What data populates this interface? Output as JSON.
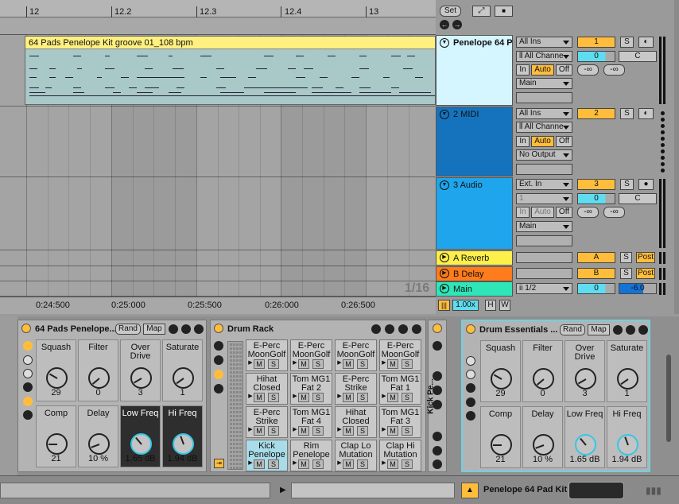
{
  "arrangement": {
    "ruler_marks": [
      "12",
      "12.2",
      "12.3",
      "12.4",
      "13"
    ],
    "time_marks": [
      "0:24:500",
      "0:25:000",
      "0:25:500",
      "0:26:000",
      "0:26:500"
    ],
    "zoom_label": "1/16",
    "set_button": "Set",
    "clip_name": "64 Pads Penelope Kit groove 01_108 bpm"
  },
  "tracks": [
    {
      "name": "Penelope 64 P",
      "input": "All Ins",
      "channel": "All Channe",
      "monitor": [
        "In",
        "Auto",
        "Off"
      ],
      "output": "Main",
      "number": "1",
      "solo": "S",
      "volume": "0",
      "pan": "C",
      "send_a": "-∞",
      "send_b": "-∞"
    },
    {
      "name": "2 MIDI",
      "input": "All Ins",
      "channel": "All Channe",
      "monitor": [
        "In",
        "Auto",
        "Off"
      ],
      "output": "No Output",
      "number": "2",
      "solo": "S"
    },
    {
      "name": "3 Audio",
      "input": "Ext. In",
      "channel": "1",
      "monitor": [
        "In",
        "Auto",
        "Off"
      ],
      "output": "Main",
      "number": "3",
      "solo": "S",
      "volume": "0",
      "pan": "C",
      "send_a": "-∞",
      "send_b": "-∞"
    },
    {
      "name": "A Reverb",
      "number": "A",
      "solo": "S",
      "post": "Post"
    },
    {
      "name": "B Delay",
      "number": "B",
      "solo": "S",
      "post": "Post"
    },
    {
      "name": "Main",
      "cue": "1/2",
      "volume": "0",
      "master_vol": "-6.0"
    }
  ],
  "transport": {
    "tempo_scale": "1.00x",
    "h_label": "H",
    "w_label": "W"
  },
  "devices": {
    "rack1": {
      "title": "64 Pads Penelope...",
      "rand": "Rand",
      "map": "Map",
      "macros": [
        {
          "label": "Squash",
          "value": "29"
        },
        {
          "label": "Filter",
          "value": "0"
        },
        {
          "label": "Over Drive",
          "value": "3"
        },
        {
          "label": "Saturate",
          "value": "1"
        },
        {
          "label": "Comp",
          "value": "21"
        },
        {
          "label": "Delay",
          "value": "10 %"
        },
        {
          "label": "Low Freq",
          "value": "1.65 dB"
        },
        {
          "label": "Hi Freq",
          "value": "1.94 dB"
        }
      ]
    },
    "drum_rack": {
      "title": "Drum Rack",
      "pads": [
        "E-Perc MoonGolf",
        "E-Perc MoonGolf",
        "E-Perc MoonGolf",
        "E-Perc MoonGolf",
        "Hihat Closed",
        "Tom MG1 Fat 2",
        "E-Perc Strike",
        "Tom MG1 Fat 1",
        "E-Perc Strike",
        "Tom MG1 Fat 4",
        "Hihat Closed",
        "Tom MG1 Fat 3",
        "Kick Penelope",
        "Rim Penelope",
        "Clap Lo Mutation",
        "Clap Hi Mutation"
      ],
      "pad_m": "M",
      "pad_s": "S",
      "chain_label": "Kick Pe..."
    },
    "rack2": {
      "title": "Drum Essentials ...",
      "rand": "Rand",
      "map": "Map",
      "macros": [
        {
          "label": "Squash",
          "value": "29"
        },
        {
          "label": "Filter",
          "value": "0"
        },
        {
          "label": "Over Drive",
          "value": "3"
        },
        {
          "label": "Saturate",
          "value": "1"
        },
        {
          "label": "Comp",
          "value": "21"
        },
        {
          "label": "Delay",
          "value": "10 %"
        },
        {
          "label": "Low Freq",
          "value": "1.65 dB"
        },
        {
          "label": "Hi Freq",
          "value": "1.94 dB"
        }
      ]
    }
  },
  "status_bar": {
    "track_label": "Penelope 64 Pad Kit"
  },
  "colors": {
    "clip_yellow": "#fff080",
    "track1": "#d6f6ff",
    "track2": "#1573bd",
    "track3": "#1ea5ec",
    "reverb": "#ffef4a",
    "delay": "#ff7c1c",
    "main": "#2fe6b8",
    "accent": "#ffbd3b"
  }
}
